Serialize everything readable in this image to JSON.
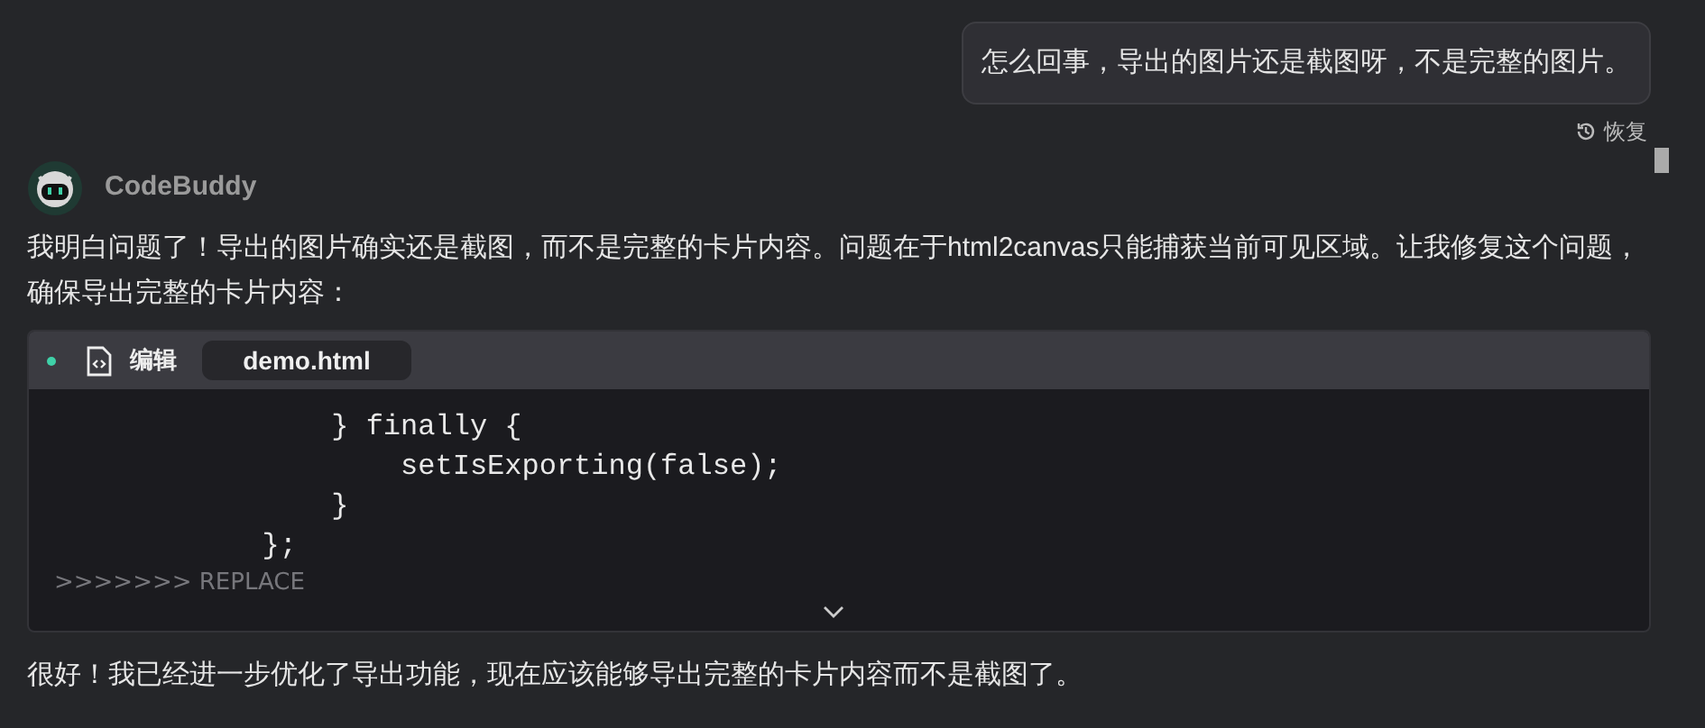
{
  "user_message": {
    "text": "怎么回事，导出的图片还是截图呀，不是完整的图片。",
    "restore": "恢复"
  },
  "assistant": {
    "name": "CodeBuddy",
    "intro": "我明白问题了！导出的图片确实还是截图，而不是完整的卡片内容。问题在于html2canvas只能捕获当前可见区域。让我修复这个问题，确保导出完整的卡片内容：",
    "code_card": {
      "action": "编辑",
      "file": "demo.html",
      "lines": [
        {
          "kind": "code",
          "text": "                } finally {"
        },
        {
          "kind": "code",
          "text": "                    setIsExporting(false);"
        },
        {
          "kind": "code",
          "text": "                }"
        },
        {
          "kind": "code",
          "text": "            };"
        },
        {
          "kind": "marker",
          "text": ">>>>>>> REPLACE"
        }
      ]
    },
    "outro": "很好！我已经进一步优化了导出功能，现在应该能够导出完整的卡片内容而不是截图了。"
  }
}
